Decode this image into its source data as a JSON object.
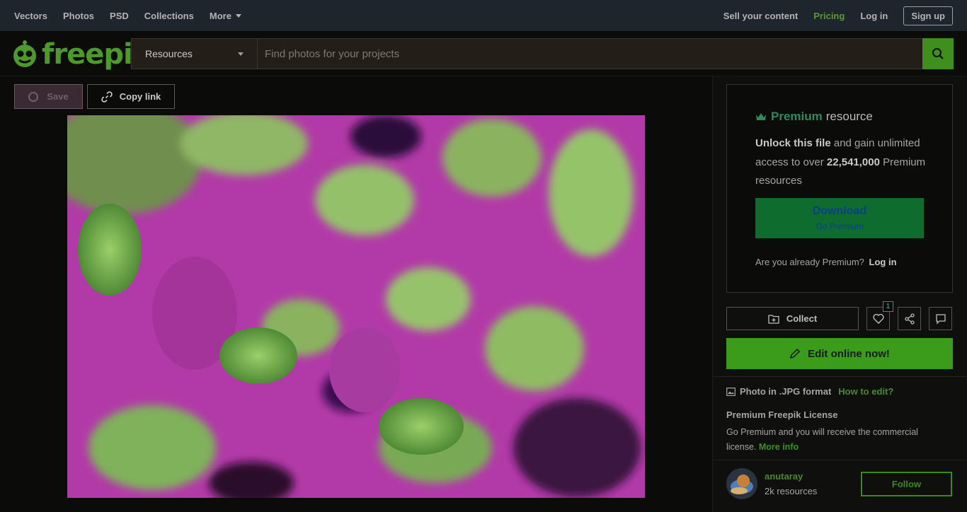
{
  "topnav": {
    "left_links": [
      "Vectors",
      "Photos",
      "PSD",
      "Collections"
    ],
    "more_label": "More",
    "sell_label": "Sell your content",
    "pricing_label": "Pricing",
    "login_label": "Log in",
    "signup_label": "Sign up"
  },
  "logo": {
    "text": "freepik",
    "icon": "freepik-logo-icon"
  },
  "search": {
    "category": "Resources",
    "placeholder": "Find photos for your projects",
    "value": "",
    "icon": "search-icon"
  },
  "toolbar": {
    "save_label": "Save",
    "copy_label": "Copy link"
  },
  "premium": {
    "premium_word": "Premium",
    "resource_word": "resource",
    "unlock_bold": "Unlock this file",
    "unlock_rest": " and gain unlimited access to over ",
    "count_bold": "22,541,000",
    "count_rest": " Premium resources",
    "download_label": "Download",
    "download_sub": "Go Premium",
    "already_text": "Are you already Premium?",
    "already_login": "Log in"
  },
  "actions": {
    "collect_label": "Collect",
    "like_count": "1",
    "edit_label": "Edit online now!"
  },
  "info": {
    "format_text": "Photo in .JPG format",
    "how_to_edit": "How to edit?",
    "license_title": "Premium Freepik License",
    "license_text": "Go Premium and you will receive the commercial license.",
    "more_info": "More info"
  },
  "author": {
    "name": "anutaray",
    "resources": "2k resources",
    "follow_label": "Follow"
  },
  "colors": {
    "brand_green": "#4b9a2b",
    "topnav_bg": "#1e252c",
    "download_bg": "#0d6c2e"
  }
}
